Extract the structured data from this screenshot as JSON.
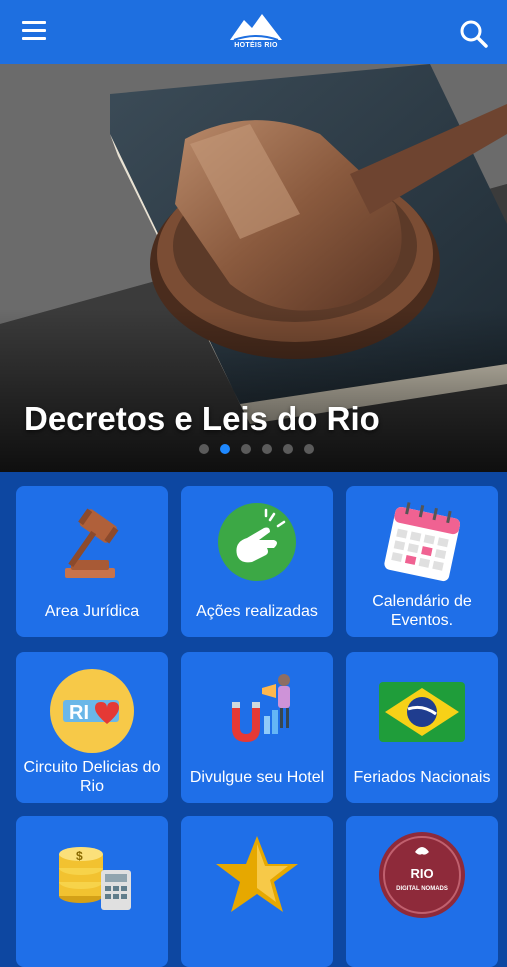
{
  "header": {
    "logo_text": "HOTÉIS RIO",
    "brand_color": "#1e6fe0"
  },
  "hero": {
    "title": "Decretos e Leis do Rio",
    "slide_count": 6,
    "active_slide": 2
  },
  "tiles": [
    {
      "label": "Area Jurídica",
      "icon": "gavel-icon"
    },
    {
      "label": "Ações realizadas",
      "icon": "hand-snap-icon"
    },
    {
      "label": "Calendário de Eventos.",
      "icon": "calendar-icon"
    },
    {
      "label": "Circuito Delicias do Rio",
      "icon": "rio-heart-badge-icon"
    },
    {
      "label": "Divulgue seu Hotel",
      "icon": "megaphone-magnet-icon"
    },
    {
      "label": "Feriados Nacionais",
      "icon": "brazil-flag-icon"
    },
    {
      "label": "",
      "icon": "coins-calculator-icon"
    },
    {
      "label": "",
      "icon": "gold-star-icon"
    },
    {
      "label": "",
      "icon": "rio-digital-nomads-icon"
    }
  ],
  "badges": {
    "rio_heart": "RI",
    "nomads_top": "RIO",
    "nomads_sub": "DIGITAL NOMADS"
  }
}
